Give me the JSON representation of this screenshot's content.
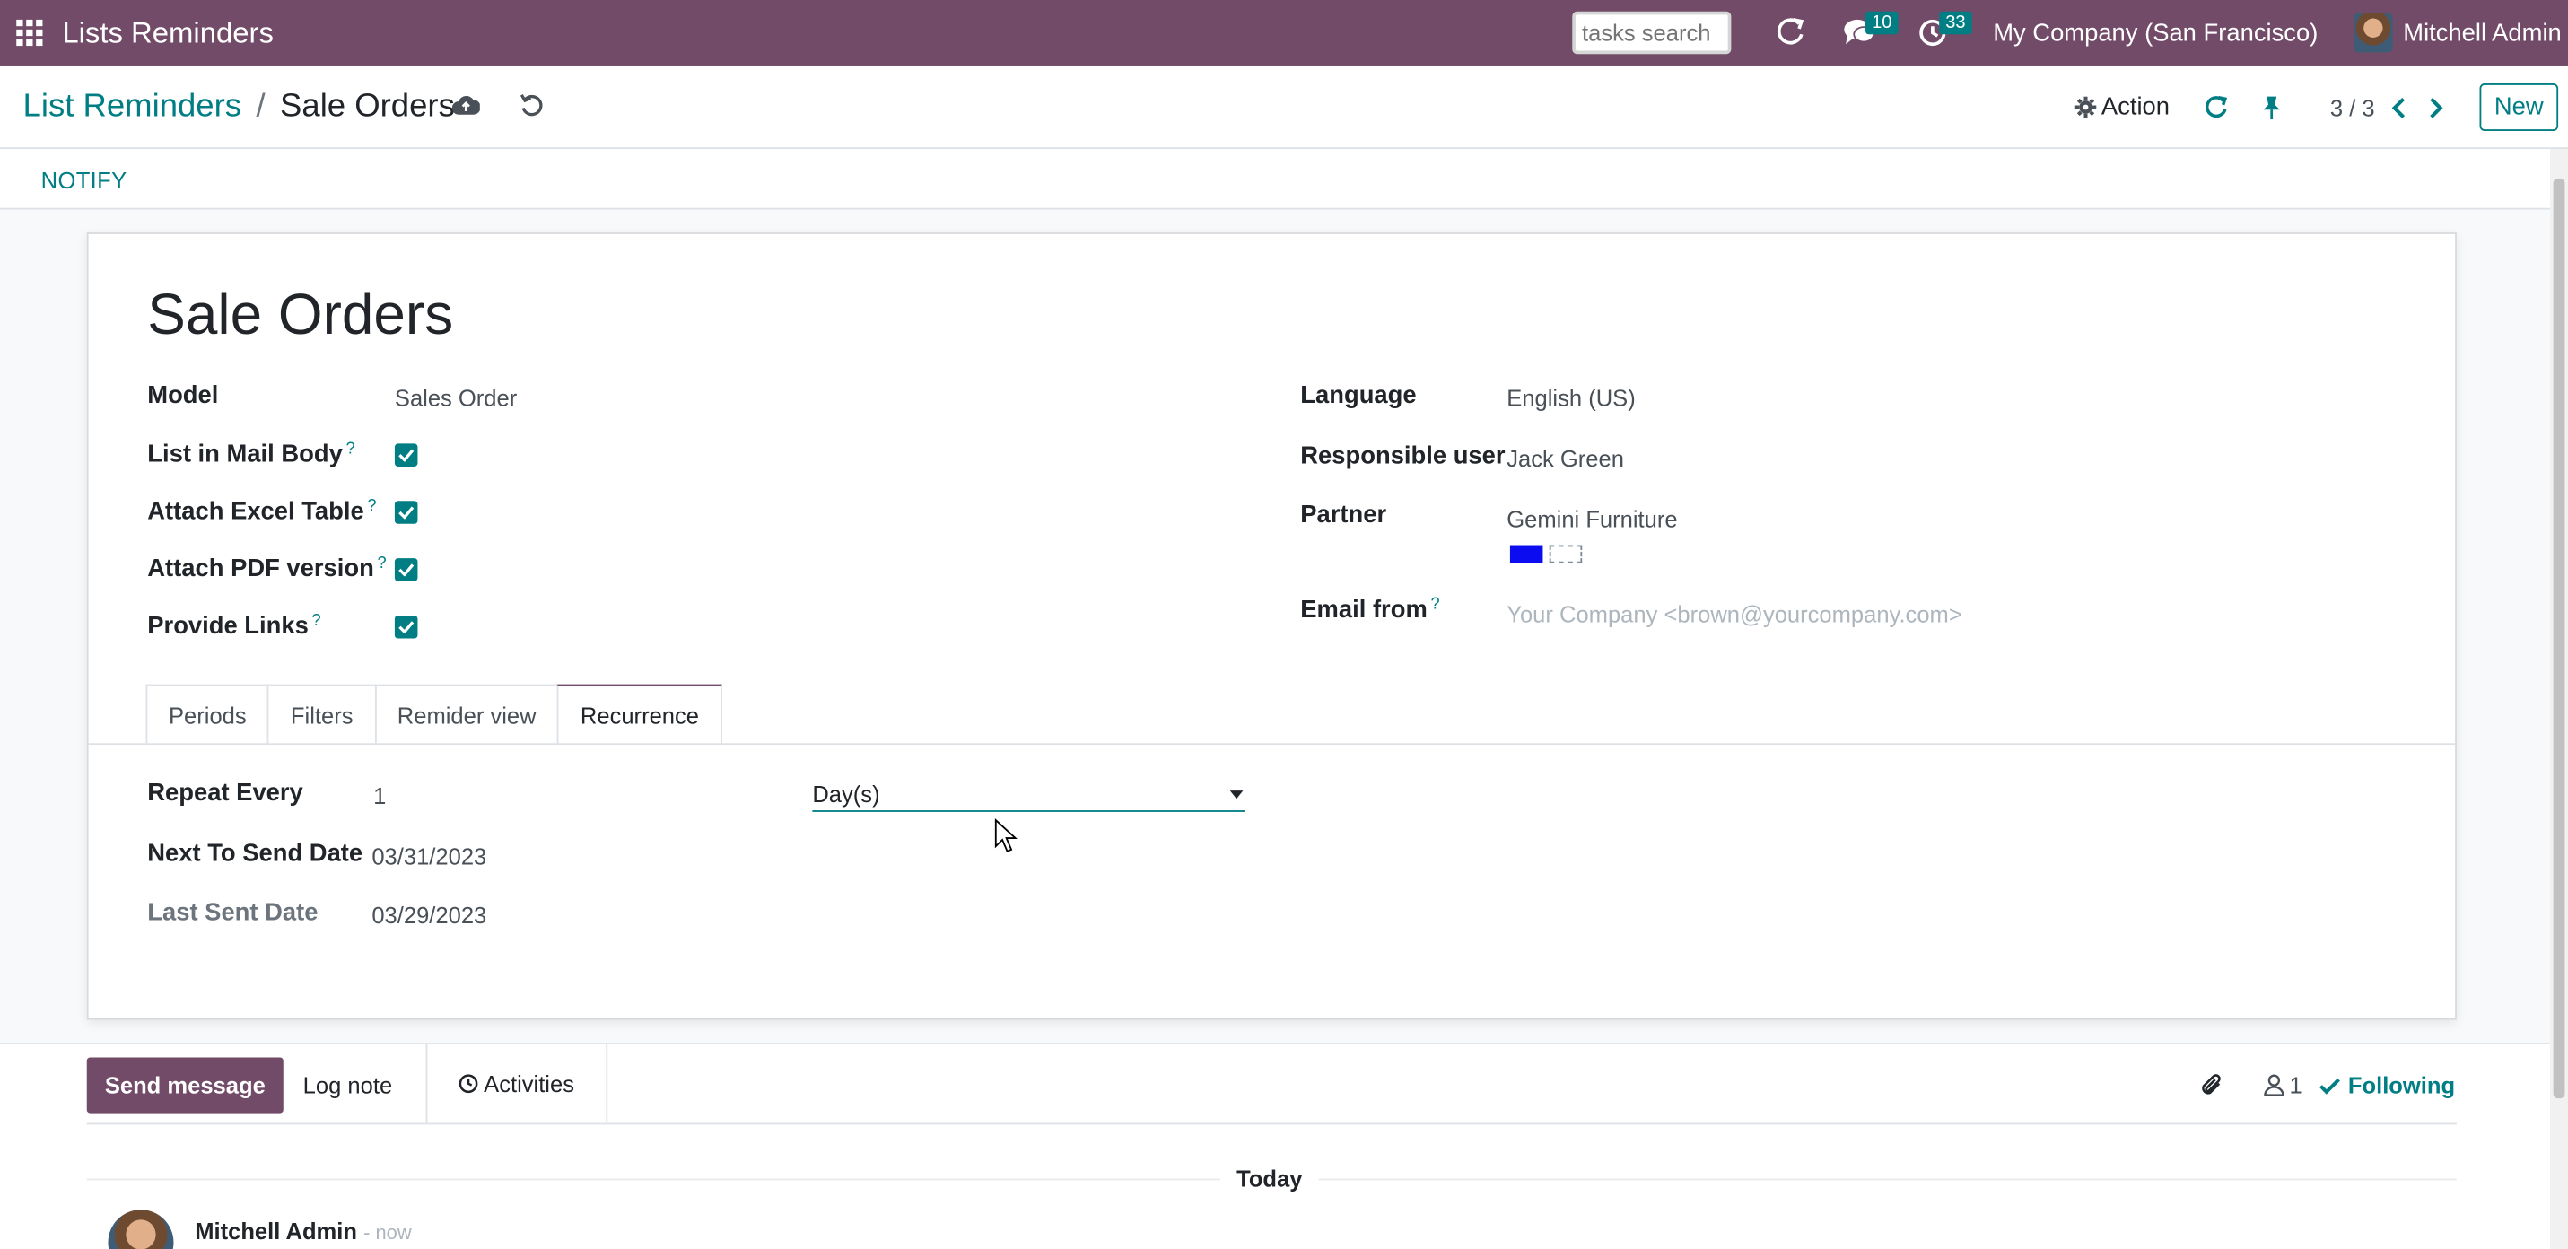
{
  "navbar": {
    "app_title": "Lists Reminders",
    "search_placeholder": "tasks search",
    "messages_count": "10",
    "activities_count": "33",
    "company": "My Company (San Francisco)",
    "user": "Mitchell Admin"
  },
  "control_panel": {
    "breadcrumb_parent": "List Reminders",
    "breadcrumb_separator": "/",
    "breadcrumb_current": "Sale Orders",
    "action_label": "Action",
    "pager": "3 / 3",
    "new_label": "New"
  },
  "statusbar": {
    "notify_label": "NOTIFY"
  },
  "form": {
    "title": "Sale Orders",
    "left_fields": {
      "model_label": "Model",
      "model_value": "Sales Order",
      "list_in_mail_body_label": "List in Mail Body",
      "attach_excel_label": "Attach Excel Table",
      "attach_pdf_label": "Attach PDF version",
      "provide_links_label": "Provide Links",
      "help_mark": "?"
    },
    "right_fields": {
      "language_label": "Language",
      "language_value": "English (US)",
      "responsible_label": "Responsible user",
      "responsible_value": "Jack Green",
      "partner_label": "Partner",
      "partner_value": "Gemini Furniture",
      "email_from_label": "Email from",
      "email_from_placeholder": "Your Company <brown@yourcompany.com>"
    },
    "tabs": [
      "Periods",
      "Filters",
      "Remider view",
      "Recurrence"
    ],
    "active_tab": "Recurrence",
    "recurrence": {
      "repeat_every_label": "Repeat Every",
      "repeat_every_value": "1",
      "repeat_unit": "Day(s)",
      "next_send_label": "Next To Send Date",
      "next_send_value": "03/31/2023",
      "last_sent_label": "Last Sent Date",
      "last_sent_value": "03/29/2023"
    },
    "colors": {
      "partner_color": "#0c0cf0"
    }
  },
  "chatter": {
    "send_message": "Send message",
    "log_note": "Log note",
    "activities": "Activities",
    "followers_count": "1",
    "following": "Following",
    "today_label": "Today",
    "message_author": "Mitchell Admin",
    "message_time": "- now"
  },
  "theme": {
    "primary": "#714b67",
    "accent": "#017e84"
  }
}
